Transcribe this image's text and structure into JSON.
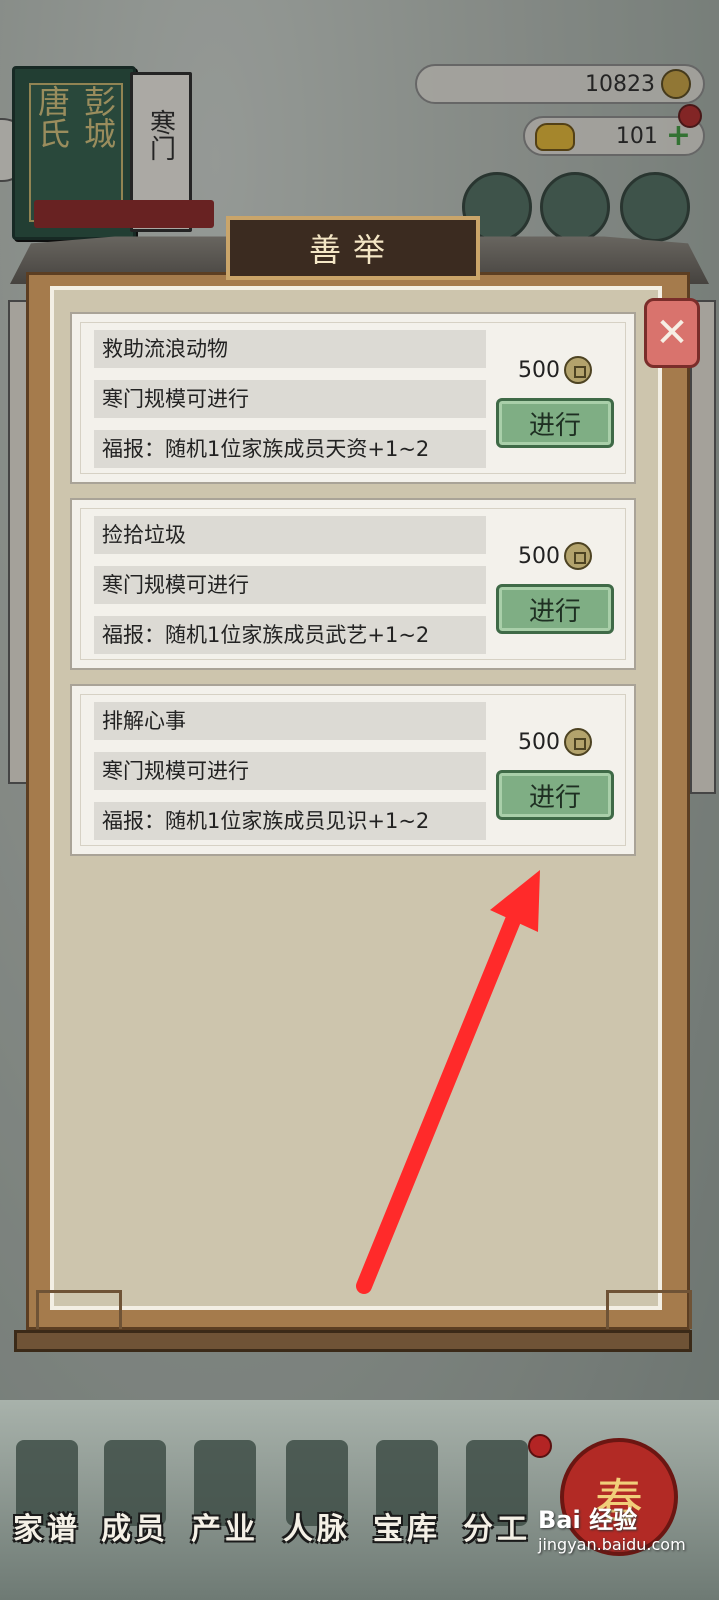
{
  "clan": {
    "name": "彭城唐氏",
    "rank": "寒门"
  },
  "currency": {
    "copper": "10823",
    "gold": "101"
  },
  "panel": {
    "title": "善举",
    "close_icon": "close-icon"
  },
  "deeds": [
    {
      "name": "救助流浪动物",
      "requirement": "寒门规模可进行",
      "reward": "福报：随机1位家族成员天资+1~2",
      "cost": "500",
      "button": "进行"
    },
    {
      "name": "捡拾垃圾",
      "requirement": "寒门规模可进行",
      "reward": "福报：随机1位家族成员武艺+1~2",
      "cost": "500",
      "button": "进行"
    },
    {
      "name": "排解心事",
      "requirement": "寒门规模可进行",
      "reward": "福报：随机1位家族成员见识+1~2",
      "cost": "500",
      "button": "进行"
    }
  ],
  "bottom_nav": [
    {
      "label": "家谱"
    },
    {
      "label": "成员"
    },
    {
      "label": "产业"
    },
    {
      "label": "人脉"
    },
    {
      "label": "宝库"
    },
    {
      "label": "分工"
    }
  ],
  "spring_badge": "春",
  "watermark": {
    "brand": "Bai 经验",
    "url": "jingyan.baidu.com"
  },
  "colors": {
    "accent_green": "#7fae84",
    "close_red": "#d9736d",
    "arrow_red": "#ff2a2a"
  }
}
